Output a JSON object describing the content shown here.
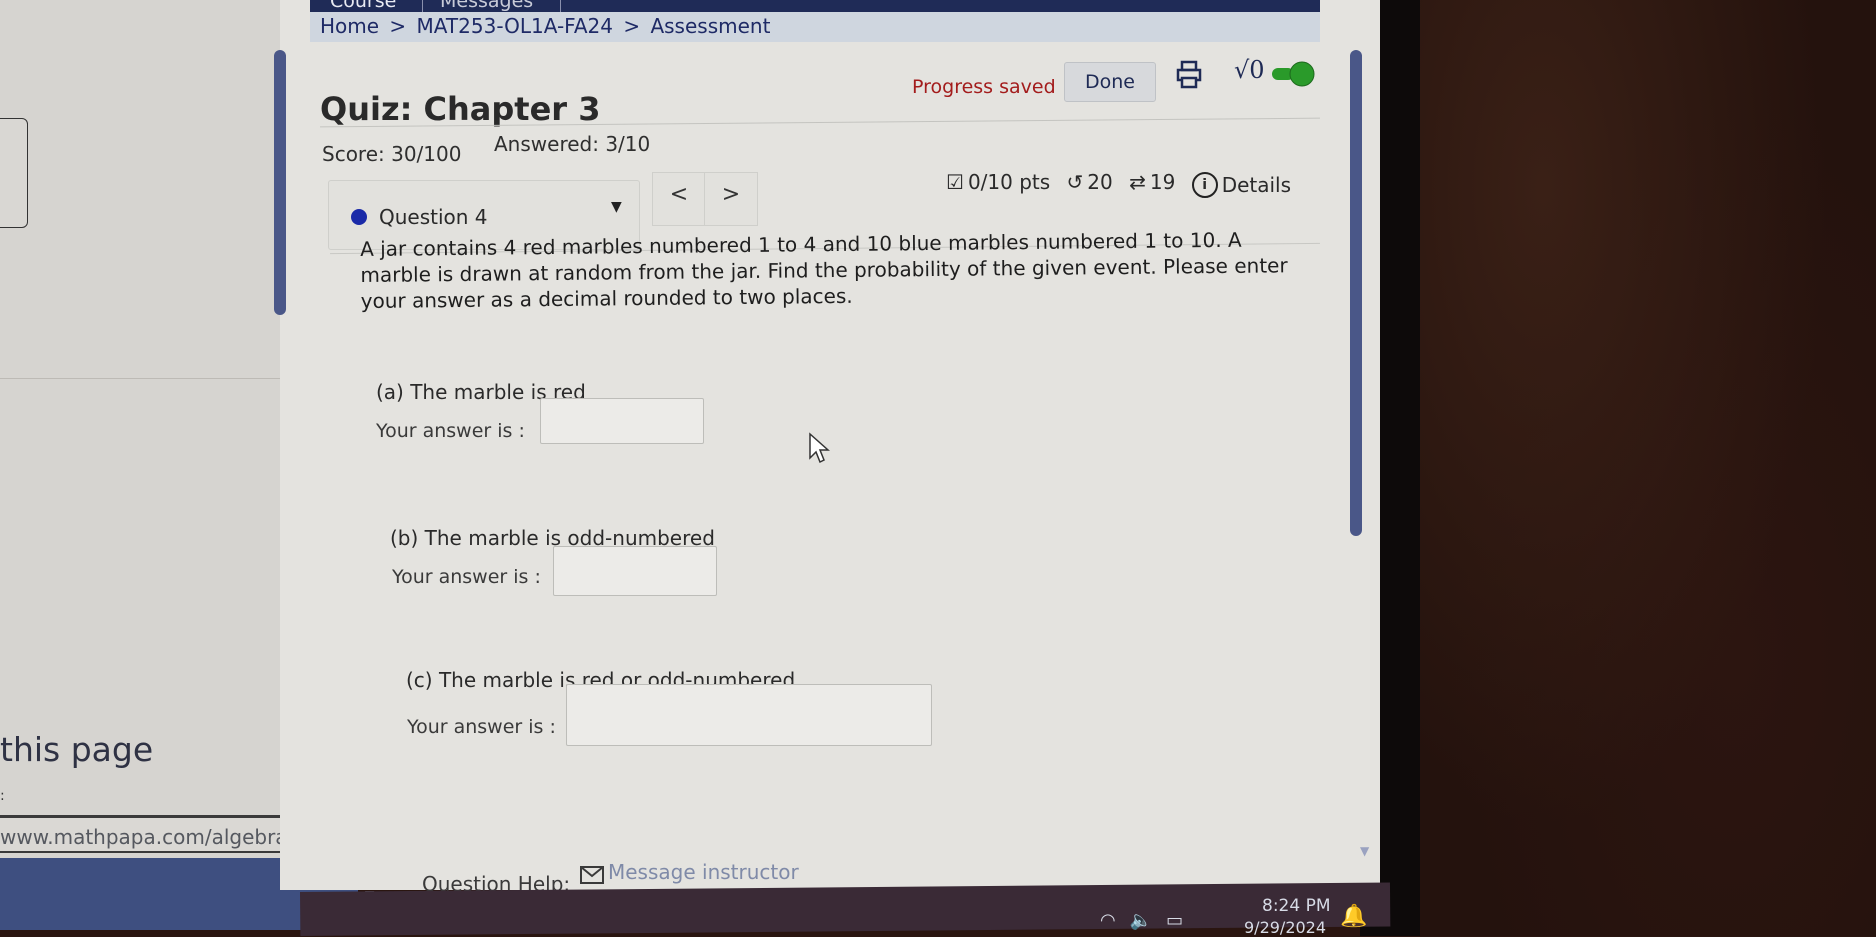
{
  "nav": {
    "tabs": [
      "Course",
      "Messages"
    ]
  },
  "breadcrumb": [
    "Home",
    ">",
    "MAT253-OL1A-FA24",
    ">",
    "Assessment"
  ],
  "quiz": {
    "title": "Quiz: Chapter 3",
    "progress_status": "Progress saved",
    "done_label": "Done",
    "score": "Score: 30/100",
    "answered": "Answered: 3/10"
  },
  "question_nav": {
    "selected": "Question 4",
    "prev_label": "<",
    "next_label": ">"
  },
  "question_meta": {
    "points": "0/10 pts",
    "retries": "20",
    "attempts": "19",
    "details_label": "Details"
  },
  "question": {
    "prompt": "A jar contains 4 red marbles numbered 1 to 4 and 10 blue marbles numbered 1 to 10. A marble is drawn at random from the jar. Find the probability of the given event. Please enter your answer as a decimal rounded to two places.",
    "parts": [
      {
        "label": "(a) The marble is red",
        "answer_label": "Your answer is :",
        "value": ""
      },
      {
        "label": "(b) The marble is odd-numbered",
        "answer_label": "Your answer is :",
        "value": ""
      },
      {
        "label": "(c) The marble is red or odd-numbered",
        "answer_label": "Your answer is :",
        "value": ""
      }
    ]
  },
  "help": {
    "label": "Question Help:",
    "link": "Message instructor"
  },
  "left_page": {
    "text": "this page",
    "url_field": "www.mathpapa.com/algebra-ca"
  },
  "taskbar": {
    "time": "8:24 PM",
    "date": "9/29/2024"
  },
  "colors": {
    "accent": "#1f2b57",
    "progress_saved": "#a31c1c",
    "toggle_on": "#2a9a2a",
    "question_dot": "#1a2aa8"
  }
}
